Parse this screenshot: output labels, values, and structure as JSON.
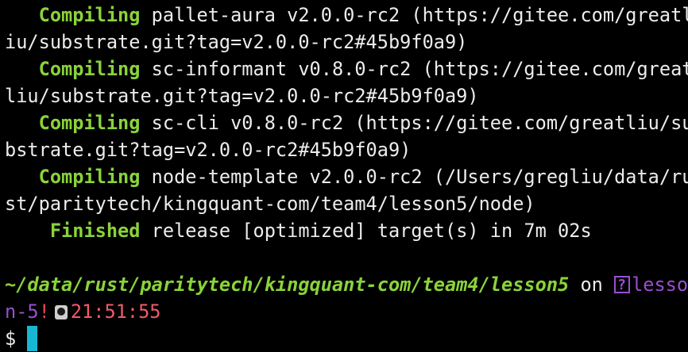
{
  "terminal": {
    "lines": {
      "l1": {
        "indent": "   ",
        "keyword": "Compiling",
        "text": " pallet-aura v2.0.0-rc2 (https://gitee.com/greatl"
      },
      "l2": {
        "text": "iu/substrate.git?tag=v2.0.0-rc2#45b9f0a9)"
      },
      "l3": {
        "indent": "   ",
        "keyword": "Compiling",
        "text": " sc-informant v0.8.0-rc2 (https://gitee.com/great"
      },
      "l4": {
        "text": "liu/substrate.git?tag=v2.0.0-rc2#45b9f0a9)"
      },
      "l5": {
        "indent": "   ",
        "keyword": "Compiling",
        "text": " sc-cli v0.8.0-rc2 (https://gitee.com/greatliu/su"
      },
      "l6": {
        "text": "bstrate.git?tag=v2.0.0-rc2#45b9f0a9)"
      },
      "l7": {
        "indent": "   ",
        "keyword": "Compiling",
        "text": " node-template v2.0.0-rc2 (/Users/gregliu/data/ru"
      },
      "l8": {
        "text": "st/paritytech/kingquant-com/team4/lesson5/node)"
      },
      "l9": {
        "indent": "    ",
        "keyword": "Finished",
        "text": " release [optimized] target(s) in 7m 02s"
      }
    },
    "prompt": {
      "path": "~/data/rust/paritytech/kingquant-com/team4/lesson5",
      "on": " on ",
      "branch_part1": "lesso",
      "branch_part2": "n-5",
      "dirty_marker": "!",
      "time": "21:51:55",
      "symbol": "$ "
    }
  },
  "colors": {
    "background": "#000000",
    "text": "#ececec",
    "keyword": "#8ad33a",
    "branch": "#9a4fd0",
    "dirty": "#e04a5a",
    "time": "#f05a6a",
    "cursor": "#19b6d4"
  },
  "icons": {
    "branch": "git-branch-icon",
    "clock": "clock-icon"
  }
}
